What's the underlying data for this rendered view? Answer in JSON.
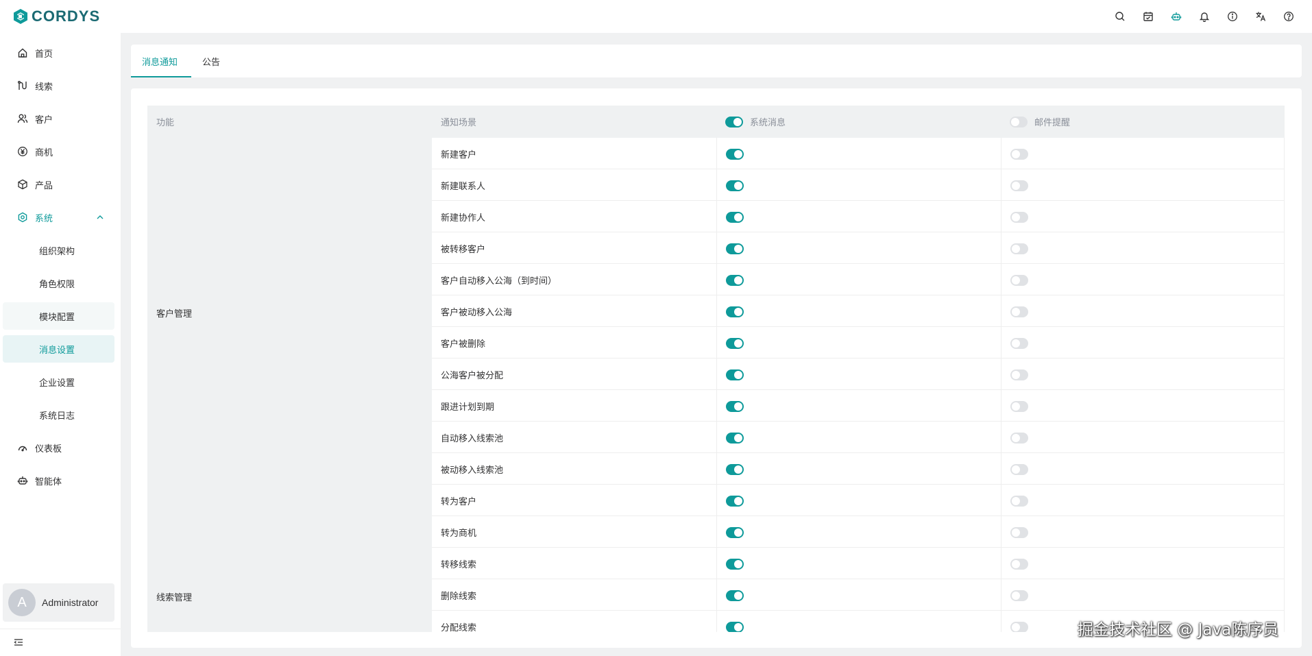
{
  "brand": {
    "name": "CORDYS",
    "color": "#1b6a73"
  },
  "accent_color": "#0e9a9a",
  "topbar": {
    "icons": [
      "search-icon",
      "calendar-icon",
      "robot-icon",
      "bell-icon",
      "info-icon",
      "translate-icon",
      "help-icon"
    ]
  },
  "sidebar": {
    "items": [
      {
        "label": "首页",
        "icon": "home-icon"
      },
      {
        "label": "线索",
        "icon": "clue-icon"
      },
      {
        "label": "客户",
        "icon": "customer-icon"
      },
      {
        "label": "商机",
        "icon": "yen-icon"
      },
      {
        "label": "产品",
        "icon": "box-icon"
      },
      {
        "label": "系统",
        "icon": "settings-icon",
        "expanded": true
      },
      {
        "label": "仪表板",
        "icon": "dashboard-icon"
      },
      {
        "label": "智能体",
        "icon": "robot-icon"
      }
    ],
    "system_children": [
      {
        "label": "组织架构"
      },
      {
        "label": "角色权限"
      },
      {
        "label": "模块配置"
      },
      {
        "label": "消息设置",
        "selected": true
      },
      {
        "label": "企业设置"
      },
      {
        "label": "系统日志"
      }
    ],
    "user": {
      "avatar_letter": "A",
      "name": "Administrator"
    }
  },
  "tabs": [
    {
      "label": "消息通知",
      "active": true
    },
    {
      "label": "公告",
      "active": false
    }
  ],
  "table": {
    "headers": {
      "function": "功能",
      "scene": "通知场景",
      "system": "系统消息",
      "email": "邮件提醒"
    },
    "header_switches": {
      "system": true,
      "email": false
    },
    "groups": [
      {
        "label": "客户管理"
      },
      {
        "label": "线索管理"
      }
    ],
    "rows": [
      {
        "scene": "新建客户",
        "system": true,
        "email": false
      },
      {
        "scene": "新建联系人",
        "system": true,
        "email": false
      },
      {
        "scene": "新建协作人",
        "system": true,
        "email": false
      },
      {
        "scene": "被转移客户",
        "system": true,
        "email": false
      },
      {
        "scene": "客户自动移入公海（到时间）",
        "system": true,
        "email": false
      },
      {
        "scene": "客户被动移入公海",
        "system": true,
        "email": false
      },
      {
        "scene": "客户被删除",
        "system": true,
        "email": false
      },
      {
        "scene": "公海客户被分配",
        "system": true,
        "email": false
      },
      {
        "scene": "跟进计划到期",
        "system": true,
        "email": false
      },
      {
        "scene": "自动移入线索池",
        "system": true,
        "email": false
      },
      {
        "scene": "被动移入线索池",
        "system": true,
        "email": false
      },
      {
        "scene": "转为客户",
        "system": true,
        "email": false
      },
      {
        "scene": "转为商机",
        "system": true,
        "email": false
      },
      {
        "scene": "转移线索",
        "system": true,
        "email": false
      },
      {
        "scene": "删除线索",
        "system": true,
        "email": false
      },
      {
        "scene": "分配线索",
        "system": true,
        "email": false
      }
    ]
  },
  "watermark": "掘金技术社区 @ Java陈序员"
}
